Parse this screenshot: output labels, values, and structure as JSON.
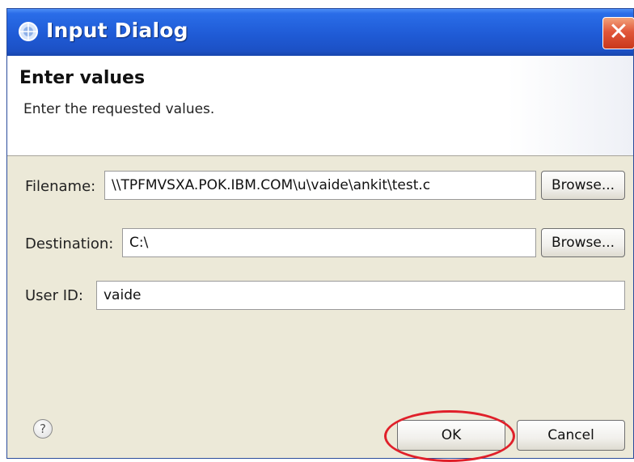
{
  "window": {
    "title": "Input Dialog",
    "close_glyph": "✕"
  },
  "header": {
    "title": "Enter values",
    "description": "Enter the requested values."
  },
  "form": {
    "filename": {
      "label": "Filename:",
      "value": "\\\\TPFMVSXA.POK.IBM.COM\\u\\vaide\\ankit\\test.c",
      "browse_label": "Browse..."
    },
    "destination": {
      "label": "Destination:",
      "value": "C:\\",
      "browse_label": "Browse..."
    },
    "user_id": {
      "label": "User ID:",
      "value": "vaide"
    }
  },
  "footer": {
    "help_glyph": "?",
    "ok_label": "OK",
    "cancel_label": "Cancel"
  },
  "colors": {
    "titlebar": "#1f5bd6",
    "close_button": "#e1573a",
    "highlight_ring": "#e0202a",
    "dialog_background": "#ece9d8"
  },
  "icons": {
    "title": "globe-icon",
    "help": "help-icon",
    "close": "close-icon"
  }
}
